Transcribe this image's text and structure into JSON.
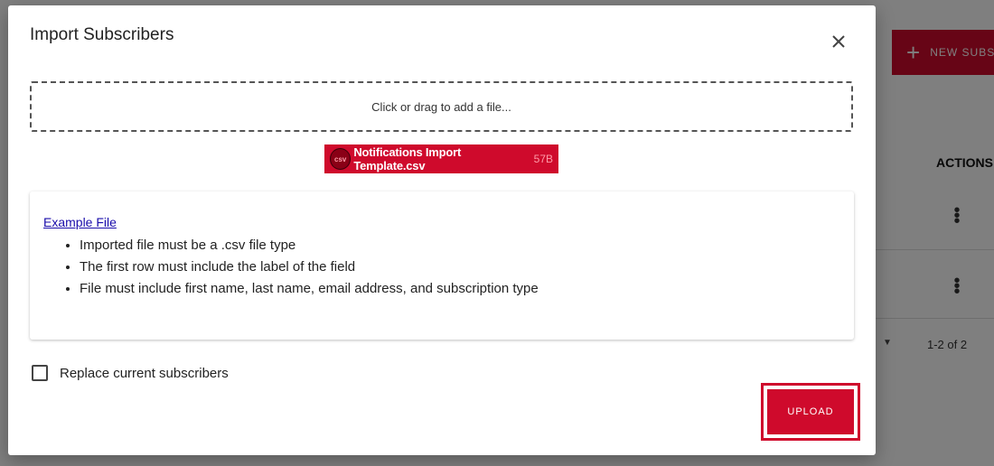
{
  "background": {
    "new_button_label": "NEW SUBS",
    "actions_header": "ACTIONS",
    "pagination_count": "1-2 of 2"
  },
  "dialog": {
    "title": "Import Subscribers",
    "dropzone_text": "Click or drag to add a file...",
    "file": {
      "type_badge": "csv",
      "name": "Notifications Import Template.csv",
      "size": "57B"
    },
    "info": {
      "example_link": "Example File",
      "rules": [
        "Imported file must be a .csv file type",
        "The first row must include the label of the field",
        "File must include first name, last name, email address, and subscription type"
      ]
    },
    "replace_checkbox_label": "Replace current subscribers",
    "replace_checked": false,
    "upload_label": "UPLOAD"
  },
  "colors": {
    "accent": "#cf0a2c",
    "overlay": "rgba(0,0,0,0.5)"
  }
}
